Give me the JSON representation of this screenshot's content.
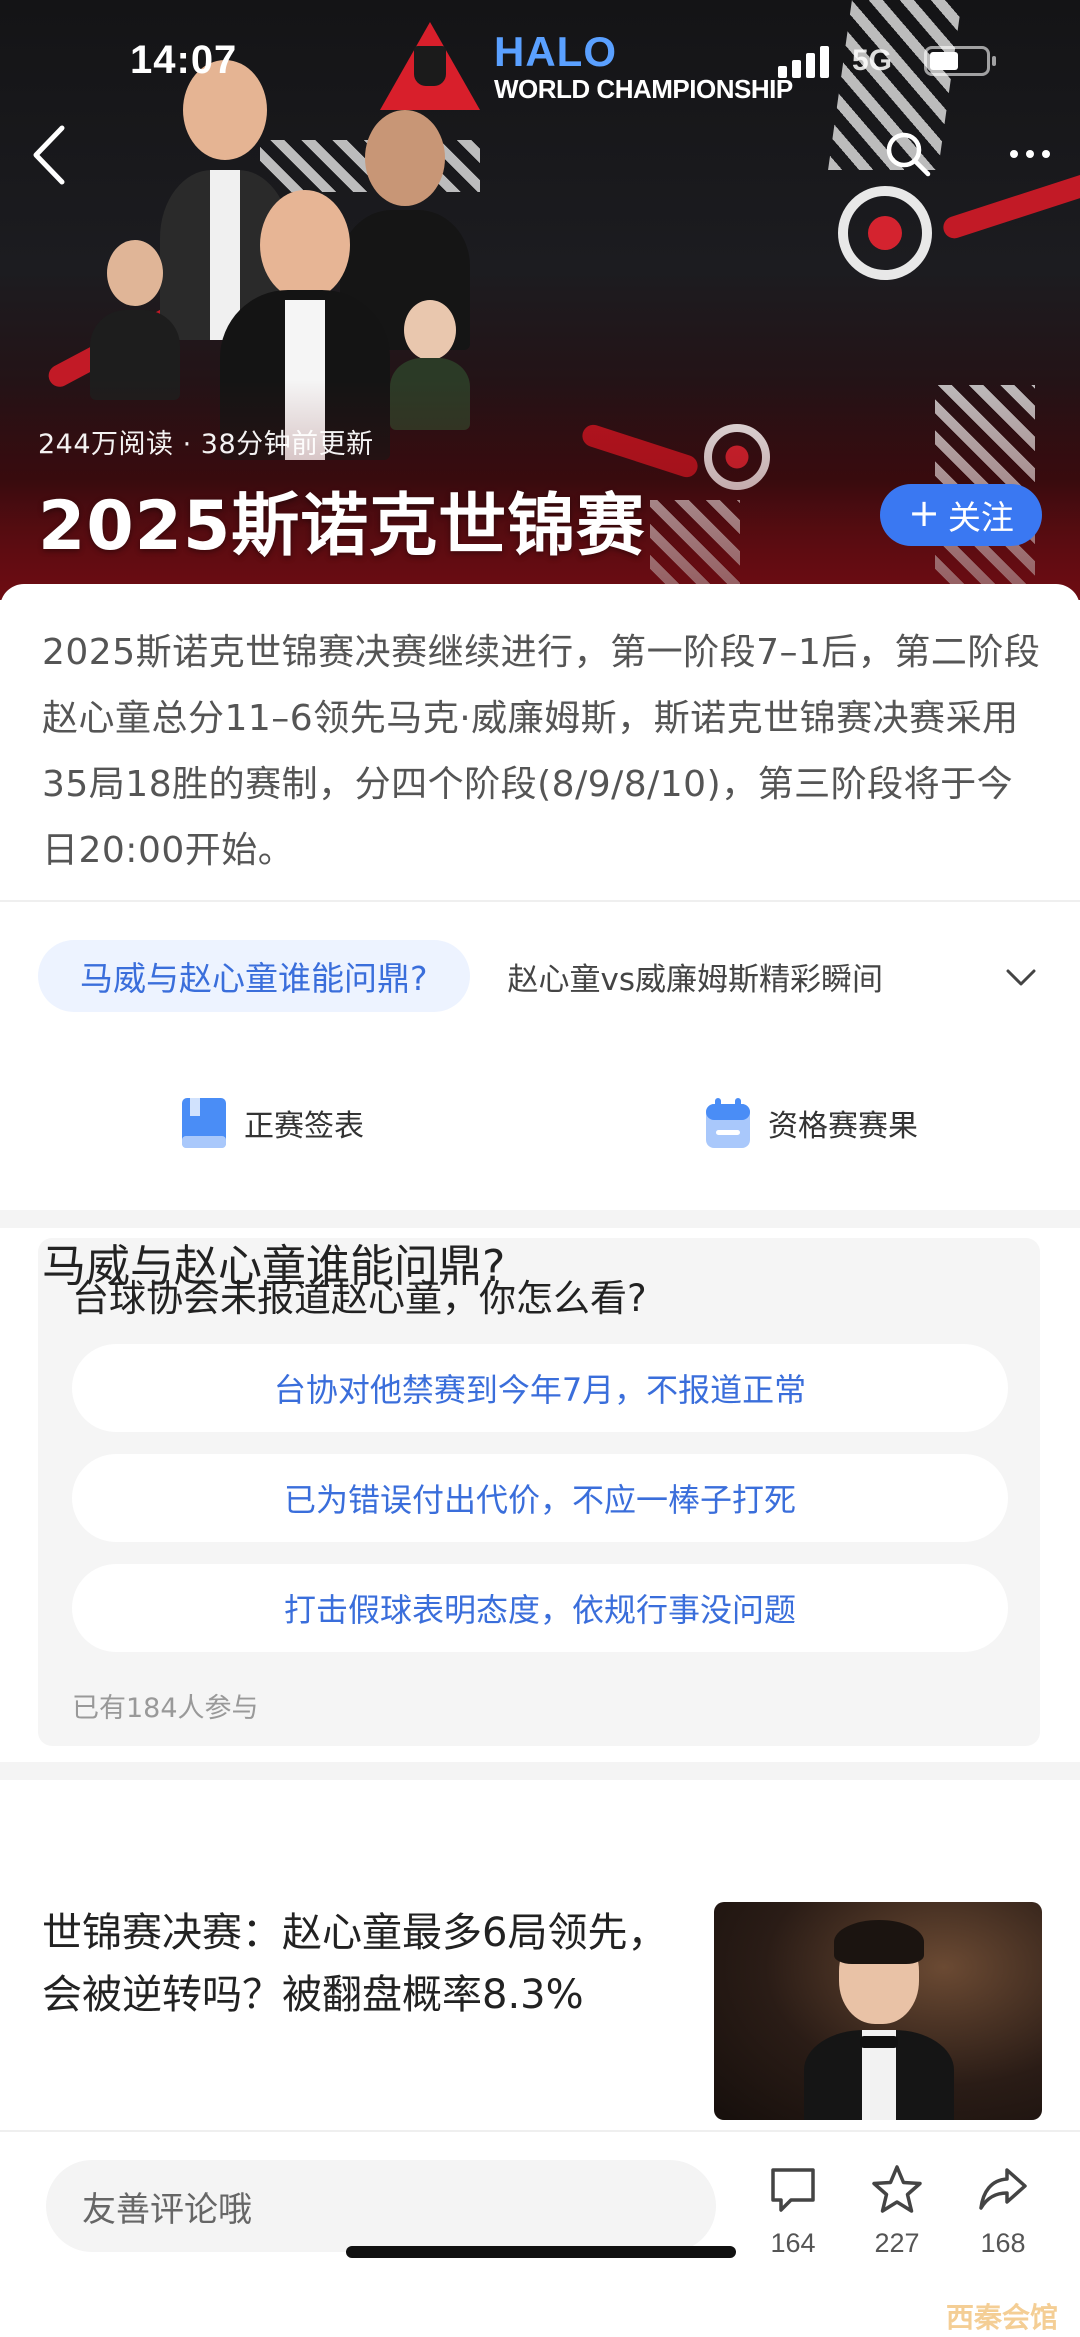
{
  "status_bar": {
    "time": "14:07",
    "network": "5G"
  },
  "hero": {
    "logo_line1": "HALO",
    "logo_line2": "WORLD CHAMPIONSHIP",
    "meta": "244万阅读 · 38分钟前更新",
    "title": "2025斯诺克世锦赛",
    "follow_label": "关注",
    "follow_icon": "plus-icon"
  },
  "summary": "2025斯诺克世锦赛决赛继续进行，第一阶段7–1后，第二阶段赵心童总分11–6领先马克·威廉姆斯，斯诺克世锦赛决赛采用35局18胜的赛制，分四个阶段(8/9/8/10)，第三阶段将于今日20:00开始。",
  "topics": {
    "active": "马威与赵心童谁能问鼎?",
    "other": "赵心童vs威廉姆斯精彩瞬间",
    "expand_icon": "chevron-down-icon"
  },
  "shortcuts": [
    {
      "label": "正赛签表",
      "icon": "book-icon"
    },
    {
      "label": "资格赛赛果",
      "icon": "calendar-icon"
    }
  ],
  "poll": {
    "question": "台球协会未报道赵心童，你怎么看?",
    "options": [
      "台协对他禁赛到今年7月，不报道正常",
      "已为错误付出代价，不应一棒子打死",
      "打击假球表明态度，依规行事没问题"
    ],
    "participants": "已有184人参与"
  },
  "section": {
    "title": "马威与赵心童谁能问鼎?",
    "article_title": "世锦赛决赛：赵心童最多6局领先，会被逆转吗？被翻盘概率8.3%"
  },
  "bottom_bar": {
    "comment_placeholder": "友善评论哦",
    "comments": "164",
    "favorites": "227",
    "shares": "168"
  },
  "watermark": "西秦会馆",
  "colors": {
    "accent": "#3a78f2",
    "link": "#3a6edb",
    "brand_red": "#d81f2b"
  }
}
